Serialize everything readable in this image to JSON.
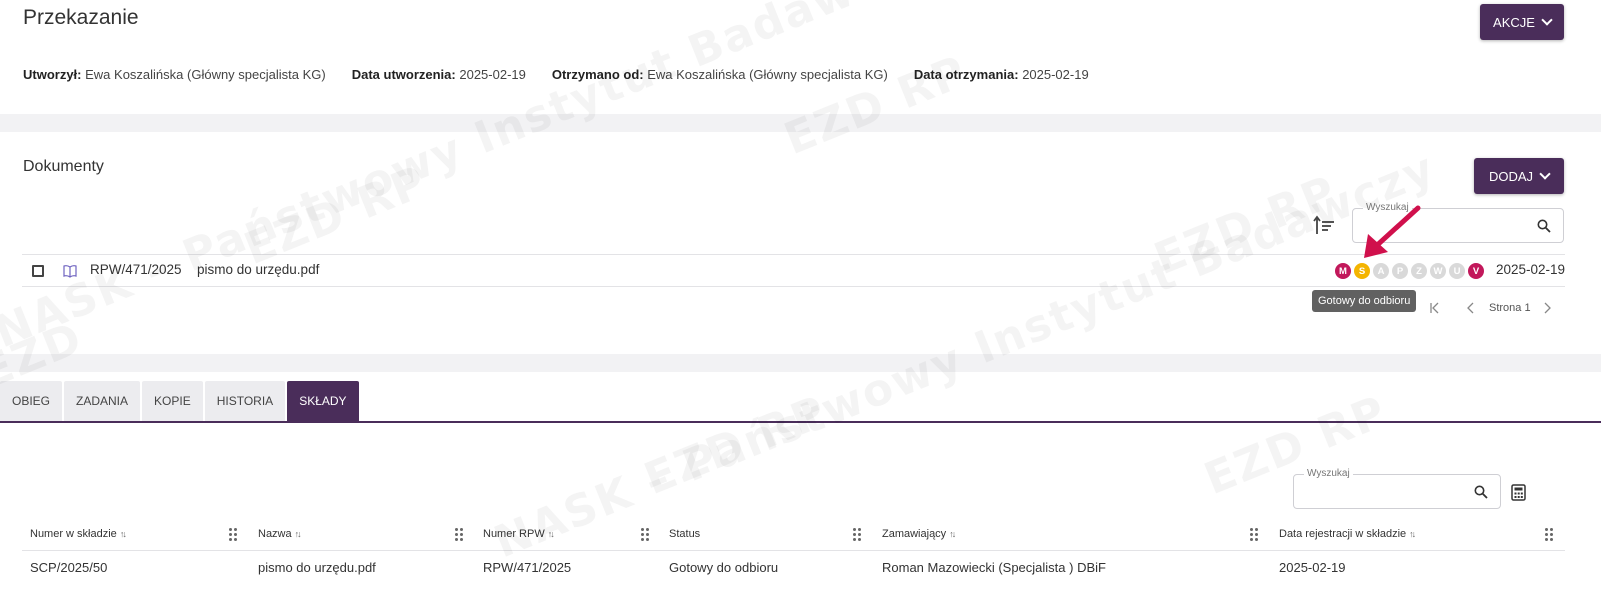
{
  "header": {
    "title": "Przekazanie",
    "actions_label": "AKCJE",
    "meta": [
      {
        "label": "Utworzył:",
        "value": "Ewa Koszalińska (Główny specjalista KG)"
      },
      {
        "label": "Data utworzenia:",
        "value": "2025-02-19"
      },
      {
        "label": "Otrzymano od:",
        "value": "Ewa Koszalińska (Główny specjalista KG)"
      },
      {
        "label": "Data otrzymania:",
        "value": "2025-02-19"
      }
    ]
  },
  "documents": {
    "title": "Dokumenty",
    "add_label": "DODAJ",
    "search_label": "Wyszukaj",
    "row": {
      "number": "RPW/471/2025",
      "name": "pismo do urzędu.pdf",
      "date": "2025-02-19",
      "statuses": [
        {
          "letter": "M",
          "color": "#c2185b"
        },
        {
          "letter": "S",
          "color": "#f4b400"
        },
        {
          "letter": "A",
          "color": "#d9d9d9"
        },
        {
          "letter": "P",
          "color": "#d9d9d9"
        },
        {
          "letter": "Z",
          "color": "#d9d9d9"
        },
        {
          "letter": "W",
          "color": "#d9d9d9"
        },
        {
          "letter": "U",
          "color": "#d9d9d9"
        },
        {
          "letter": "V",
          "color": "#c2185b"
        }
      ]
    },
    "tooltip": "Gotowy do odbioru",
    "pager": {
      "page_label": "Strona 1"
    }
  },
  "tabs": {
    "items": [
      "OBIEG",
      "ZADANIA",
      "KOPIE",
      "HISTORIA",
      "SKŁADY"
    ],
    "active": "SKŁADY"
  },
  "sklady": {
    "search_label": "Wyszukaj",
    "columns": [
      "Numer w składzie",
      "Nazwa",
      "Numer RPW",
      "Status",
      "Zamawiający",
      "Data rejestracji w składzie"
    ],
    "rows": [
      [
        "SCP/2025/50",
        "pismo do urzędu.pdf",
        "RPW/471/2025",
        "Gotowy do odbioru",
        "Roman Mazowiecki (Specjalista ) DBiF",
        "2025-02-19"
      ]
    ]
  },
  "colors": {
    "primary": "#4a2d5a",
    "arrow": "#d0104c",
    "status_active": "#c2185b",
    "status_ready": "#f4b400"
  }
}
